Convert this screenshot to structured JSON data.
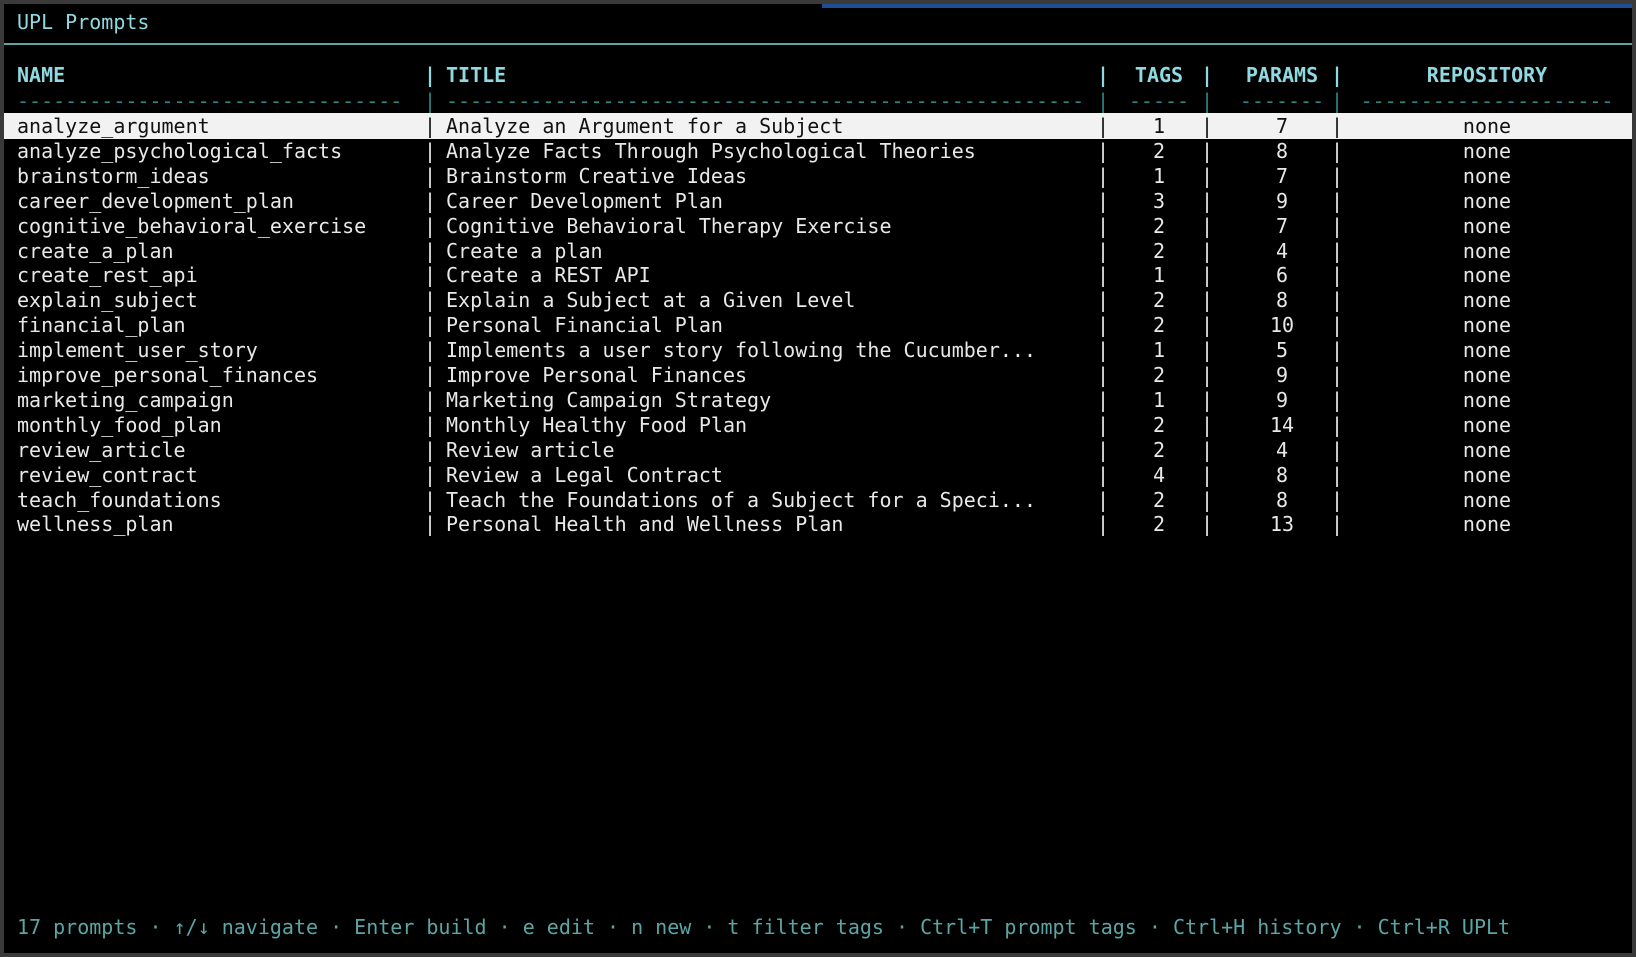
{
  "app": {
    "title": "UPL Prompts"
  },
  "table": {
    "columns": {
      "name": "NAME",
      "title": "TITLE",
      "tags": "TAGS",
      "params": "PARAMS",
      "repository": "REPOSITORY"
    },
    "separator": "|",
    "dashes": {
      "name": "--------------------------------",
      "title": "-----------------------------------------------------",
      "tags": "-----",
      "params": "-------",
      "repository": "---------------------"
    },
    "rows": [
      {
        "name": "analyze_argument",
        "title": "Analyze an Argument for a Subject",
        "tags": "1",
        "params": "7",
        "repository": "none",
        "selected": true
      },
      {
        "name": "analyze_psychological_facts",
        "title": "Analyze Facts Through Psychological Theories",
        "tags": "2",
        "params": "8",
        "repository": "none"
      },
      {
        "name": "brainstorm_ideas",
        "title": "Brainstorm Creative Ideas",
        "tags": "1",
        "params": "7",
        "repository": "none"
      },
      {
        "name": "career_development_plan",
        "title": "Career Development Plan",
        "tags": "3",
        "params": "9",
        "repository": "none"
      },
      {
        "name": "cognitive_behavioral_exercise",
        "title": "Cognitive Behavioral Therapy Exercise",
        "tags": "2",
        "params": "7",
        "repository": "none"
      },
      {
        "name": "create_a_plan",
        "title": "Create a plan",
        "tags": "2",
        "params": "4",
        "repository": "none"
      },
      {
        "name": "create_rest_api",
        "title": "Create a REST API",
        "tags": "1",
        "params": "6",
        "repository": "none"
      },
      {
        "name": "explain_subject",
        "title": "Explain a Subject at a Given Level",
        "tags": "2",
        "params": "8",
        "repository": "none"
      },
      {
        "name": "financial_plan",
        "title": "Personal Financial Plan",
        "tags": "2",
        "params": "10",
        "repository": "none"
      },
      {
        "name": "implement_user_story",
        "title": "Implements a user story following the Cucumber...",
        "tags": "1",
        "params": "5",
        "repository": "none"
      },
      {
        "name": "improve_personal_finances",
        "title": "Improve Personal Finances",
        "tags": "2",
        "params": "9",
        "repository": "none"
      },
      {
        "name": "marketing_campaign",
        "title": "Marketing Campaign Strategy",
        "tags": "1",
        "params": "9",
        "repository": "none"
      },
      {
        "name": "monthly_food_plan",
        "title": "Monthly Healthy Food Plan",
        "tags": "2",
        "params": "14",
        "repository": "none"
      },
      {
        "name": "review_article",
        "title": "Review article",
        "tags": "2",
        "params": "4",
        "repository": "none"
      },
      {
        "name": "review_contract",
        "title": "Review a Legal Contract",
        "tags": "4",
        "params": "8",
        "repository": "none"
      },
      {
        "name": "teach_foundations",
        "title": "Teach the Foundations of a Subject for a Speci...",
        "tags": "2",
        "params": "8",
        "repository": "none"
      },
      {
        "name": "wellness_plan",
        "title": "Personal Health and Wellness Plan",
        "tags": "2",
        "params": "13",
        "repository": "none"
      }
    ]
  },
  "status_bar": {
    "text": "17 prompts · ↑/↓ navigate · Enter build · e edit · n new · t filter tags · Ctrl+T prompt tags · Ctrl+H history · Ctrl+R UPLt"
  },
  "colors": {
    "background": "#000000",
    "accent": "#8fd9e0",
    "dim_accent": "#2f8585",
    "selection_bg": "#f2f2f2",
    "progress_line": "#1f4e94"
  }
}
